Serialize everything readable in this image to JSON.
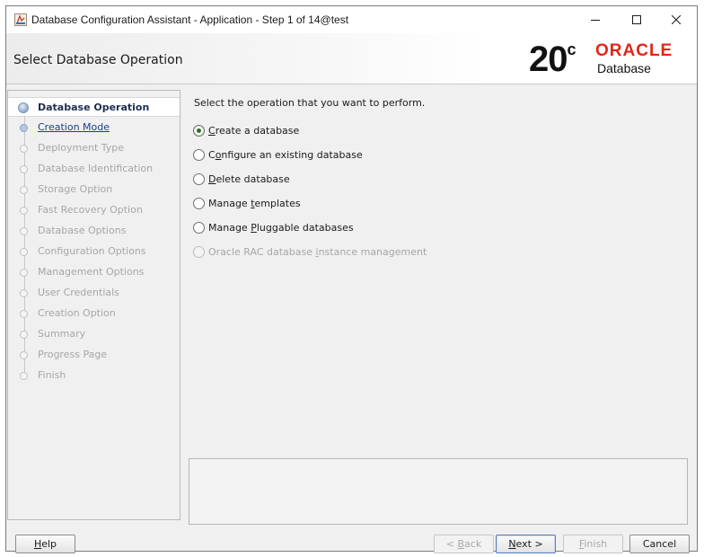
{
  "window": {
    "title": "Database Configuration Assistant - Application - Step 1 of 14@test",
    "controls": {
      "minimize": "minimize-icon",
      "maximize": "maximize-icon",
      "close": "close-icon"
    }
  },
  "header": {
    "page_title": "Select Database Operation",
    "brand": {
      "version": "20",
      "version_suffix": "c",
      "company": "ORACLE",
      "product": "Database",
      "company_color": "#E1251B"
    }
  },
  "nav": {
    "items": [
      {
        "label": "Database Operation",
        "state": "current"
      },
      {
        "label": "Creation Mode",
        "state": "link"
      },
      {
        "label": "Deployment Type",
        "state": "disabled"
      },
      {
        "label": "Database Identification",
        "state": "disabled"
      },
      {
        "label": "Storage Option",
        "state": "disabled"
      },
      {
        "label": "Fast Recovery Option",
        "state": "disabled"
      },
      {
        "label": "Database Options",
        "state": "disabled"
      },
      {
        "label": "Configuration Options",
        "state": "disabled"
      },
      {
        "label": "Management Options",
        "state": "disabled"
      },
      {
        "label": "User Credentials",
        "state": "disabled"
      },
      {
        "label": "Creation Option",
        "state": "disabled"
      },
      {
        "label": "Summary",
        "state": "disabled"
      },
      {
        "label": "Progress Page",
        "state": "disabled"
      },
      {
        "label": "Finish",
        "state": "disabled"
      }
    ]
  },
  "content": {
    "instruction": "Select the operation that you want to perform.",
    "options": [
      {
        "label": "Create a database",
        "mnemonic": "C",
        "selected": true,
        "enabled": true
      },
      {
        "label": "Configure an existing database",
        "mnemonic": "o",
        "selected": false,
        "enabled": true
      },
      {
        "label": "Delete database",
        "mnemonic": "D",
        "selected": false,
        "enabled": true
      },
      {
        "label": "Manage templates",
        "mnemonic": "t",
        "selected": false,
        "enabled": true
      },
      {
        "label": "Manage Pluggable databases",
        "mnemonic": "P",
        "selected": false,
        "enabled": true
      },
      {
        "label": "Oracle RAC database instance management",
        "mnemonic": "i",
        "selected": false,
        "enabled": false
      }
    ]
  },
  "buttons": {
    "help": "Help",
    "back": "< Back",
    "next": "Next >",
    "finish": "Finish",
    "cancel": "Cancel"
  }
}
